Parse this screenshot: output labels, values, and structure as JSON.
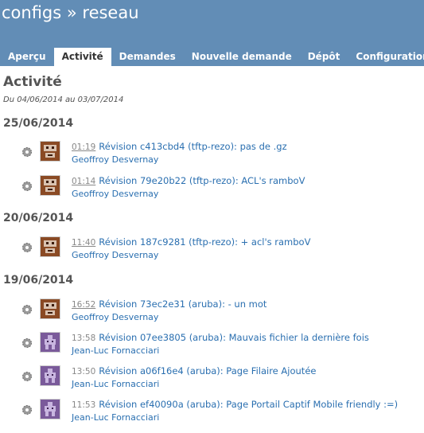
{
  "header": {
    "title": "configs » reseau",
    "tabs": [
      "Aperçu",
      "Activité",
      "Demandes",
      "Nouvelle demande",
      "Dépôt",
      "Configuration"
    ]
  },
  "activity": {
    "title": "Activité",
    "period": "Du 04/06/2014 au 03/07/2014",
    "days": [
      {
        "date": "25/06/2014",
        "events": [
          {
            "time": "01:19",
            "title": "Révision c413cbd4 (tftp-rezo): pas de .gz",
            "author": "Geoffroy Desvernay"
          },
          {
            "time": "01:14",
            "title": "Révision 79e20b22 (tftp-rezo): ACL's ramboV",
            "author": "Geoffroy Desvernay"
          }
        ]
      },
      {
        "date": "20/06/2014",
        "events": [
          {
            "time": "11:40",
            "title": "Révision 187c9281 (tftp-rezo): + acl's ramboV",
            "author": "Geoffroy Desvernay"
          }
        ]
      },
      {
        "date": "19/06/2014",
        "events": [
          {
            "time": "16:52",
            "title": "Révision 73ec2e31 (aruba): - un mot",
            "author": "Geoffroy Desvernay"
          },
          {
            "time": "13:58",
            "title": "Révision 07ee3805 (aruba): Mauvais fichier la dernière fois",
            "author": "Jean-Luc Fornacciari"
          },
          {
            "time": "13:50",
            "title": "Révision a06f16e4 (aruba): Page Filaire Ajoutée",
            "author": "Jean-Luc Fornacciari"
          },
          {
            "time": "11:53",
            "title": "Révision ef40090a (aruba): Page Portail Captif Mobile friendly :=)",
            "author": "Jean-Luc Fornacciari"
          }
        ]
      }
    ]
  },
  "icons": {
    "event": "gear-icon",
    "avatar": "user-avatar"
  },
  "colors": {
    "header": "#628db6",
    "link": "#2a6fb0",
    "avatar_brown": "#8a4a24",
    "avatar_purple": "#7a5a9a"
  }
}
